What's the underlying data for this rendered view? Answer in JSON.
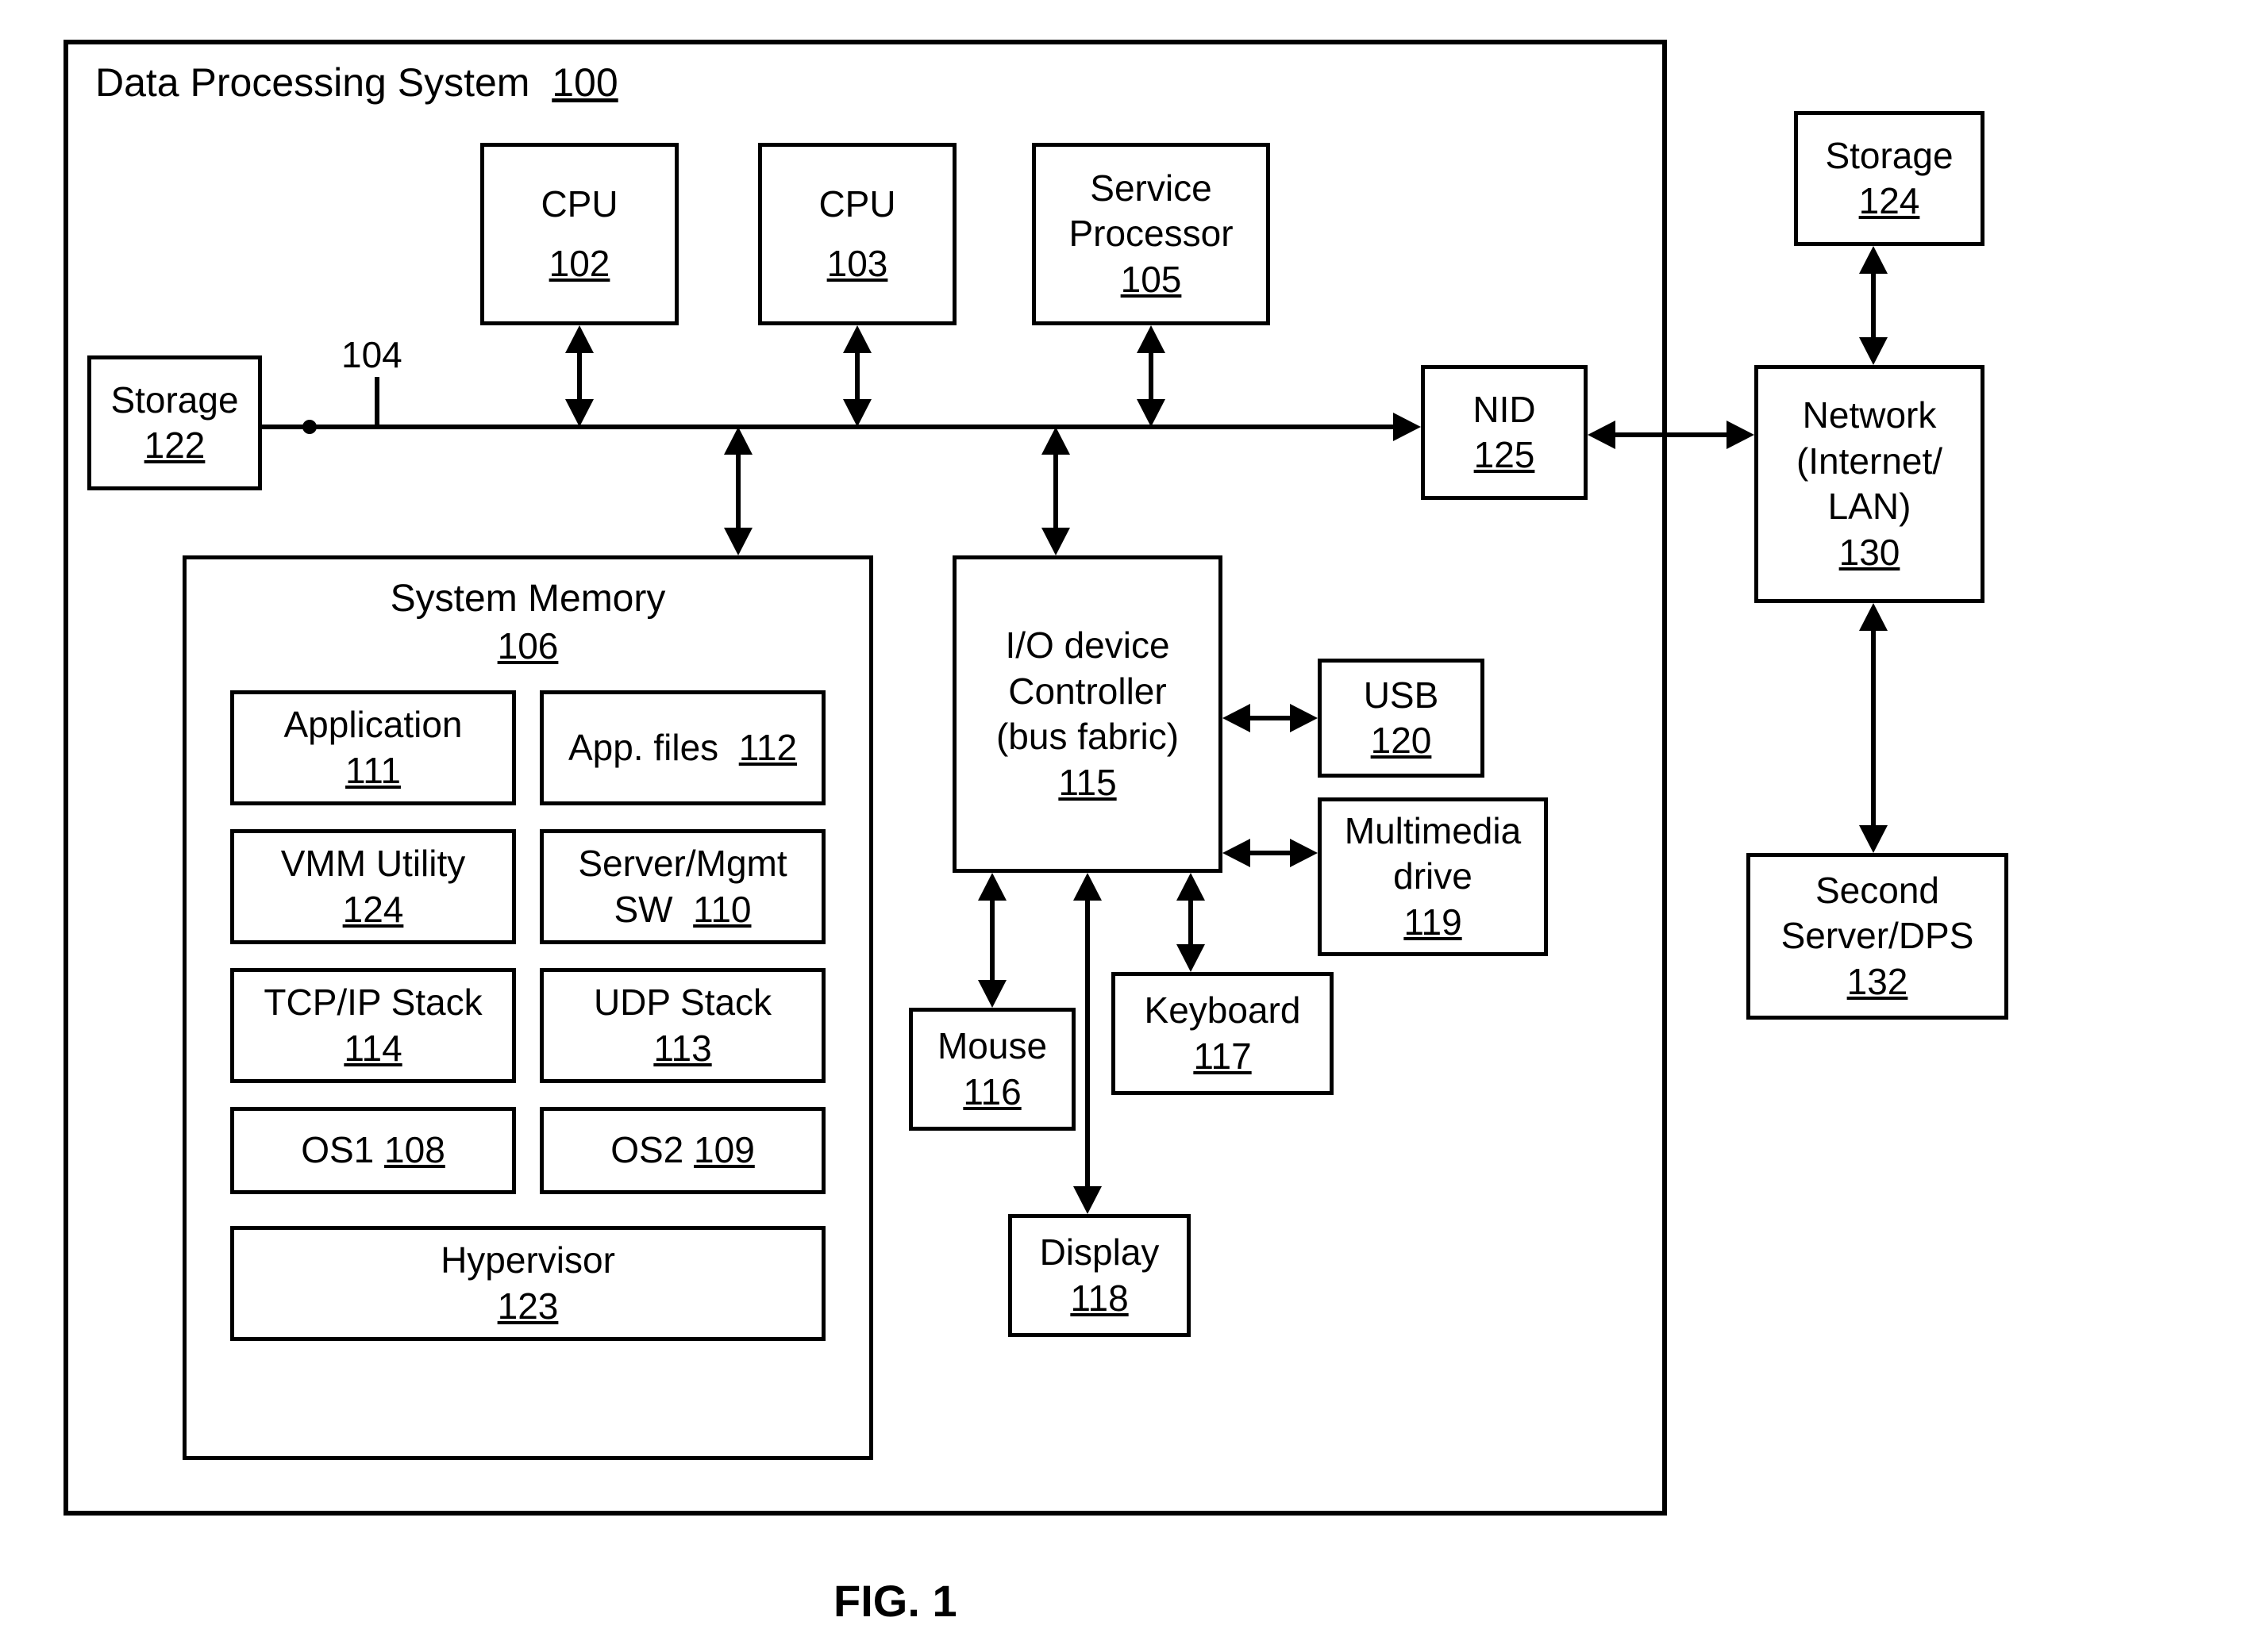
{
  "figure_label": "FIG. 1",
  "outer": {
    "title": "Data Processing System",
    "ref": "100"
  },
  "bus_ref": "104",
  "blocks": {
    "storage_l": {
      "label": "Storage",
      "ref": "122"
    },
    "cpu1": {
      "label": "CPU",
      "ref": "102"
    },
    "cpu2": {
      "label": "CPU",
      "ref": "103"
    },
    "svcproc": {
      "label1": "Service",
      "label2": "Processor",
      "ref": "105"
    },
    "nid": {
      "label": "NID",
      "ref": "125"
    },
    "sysmem": {
      "label": "System Memory",
      "ref": "106"
    },
    "app": {
      "label": "Application",
      "ref": "111"
    },
    "appfiles": {
      "label": "App. files",
      "ref": "112"
    },
    "vmm": {
      "label": "VMM Utility",
      "ref": "124"
    },
    "srvmgmt": {
      "label1": "Server/Mgmt",
      "label2": "SW",
      "ref": "110"
    },
    "tcpip": {
      "label": "TCP/IP Stack",
      "ref": "114"
    },
    "udp": {
      "label": "UDP Stack",
      "ref": "113"
    },
    "os1": {
      "label": "OS1",
      "ref": "108"
    },
    "os2": {
      "label": "OS2",
      "ref": "109"
    },
    "hyper": {
      "label": "Hypervisor",
      "ref": "123"
    },
    "ioctrl": {
      "label1": "I/O device",
      "label2": "Controller",
      "label3": "(bus fabric)",
      "ref": "115"
    },
    "usb": {
      "label": "USB",
      "ref": "120"
    },
    "mmdrive": {
      "label1": "Multimedia",
      "label2": "drive",
      "ref": "119"
    },
    "keyboard": {
      "label": "Keyboard",
      "ref": "117"
    },
    "mouse": {
      "label": "Mouse",
      "ref": "116"
    },
    "display": {
      "label": "Display",
      "ref": "118"
    },
    "storage_r": {
      "label": "Storage",
      "ref": "124"
    },
    "network": {
      "label1": "Network",
      "label2": "(Internet/",
      "label3": "LAN)",
      "ref": "130"
    },
    "server2": {
      "label1": "Second",
      "label2": "Server/DPS",
      "ref": "132"
    }
  }
}
